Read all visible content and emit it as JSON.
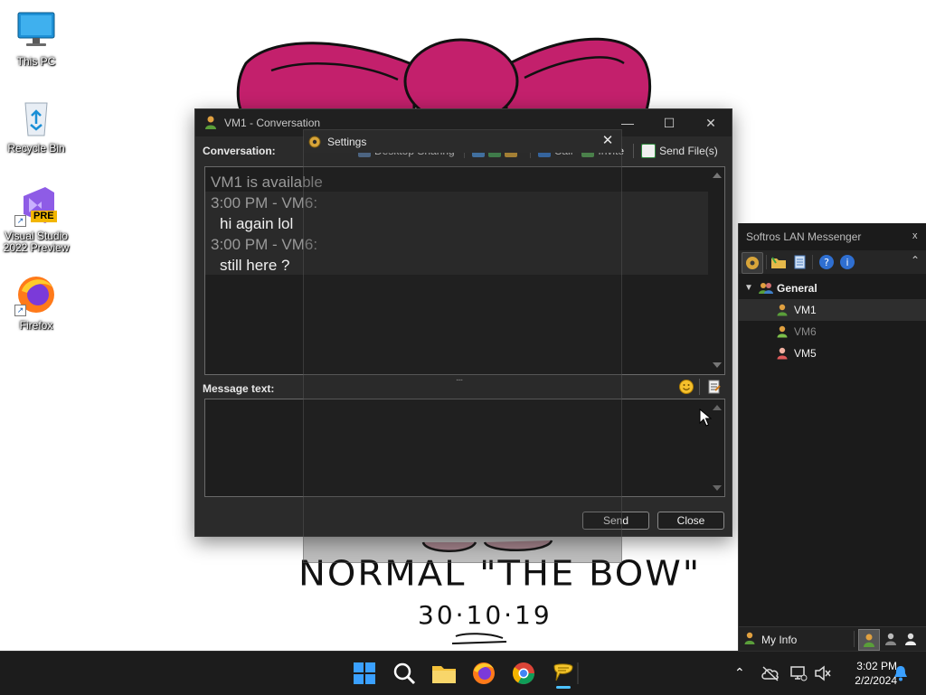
{
  "desktop": {
    "icons": [
      {
        "label": "This PC"
      },
      {
        "label": "Recycle Bin"
      },
      {
        "label": "Visual Studio 2022 Preview",
        "badge": "PRE"
      },
      {
        "label": "Firefox"
      }
    ]
  },
  "wallpaper": {
    "caption": "NORMAL \"THE BOW\"",
    "date": "30·10·19"
  },
  "conversation_window": {
    "title": "VM1 - Conversation",
    "conversation_label": "Conversation:",
    "toolbar": {
      "desktop_sharing": "Desktop Sharing",
      "call": "Call",
      "invite": "Invite",
      "send_files": "Send File(s)"
    },
    "history": [
      {
        "text": "VM1 is available",
        "kind": "status"
      },
      {
        "text": "3:00 PM - VM6:",
        "kind": "header"
      },
      {
        "text": "hi again lol",
        "kind": "message"
      },
      {
        "text": "3:00 PM - VM6:",
        "kind": "header"
      },
      {
        "text": "still here ?",
        "kind": "message"
      }
    ],
    "splitter_glyph": "....",
    "message_label": "Message text:",
    "message_value": "",
    "send_label": "Send",
    "close_label": "Close"
  },
  "settings_window": {
    "title": "Settings",
    "close_glyph": "✕"
  },
  "messenger": {
    "title": "Softros LAN Messenger",
    "close_glyph": "x",
    "group": "General",
    "contacts": [
      {
        "name": "VM1",
        "status": "online",
        "color": "#e0a040"
      },
      {
        "name": "VM6",
        "status": "away",
        "color": "#7cbf4a"
      },
      {
        "name": "VM5",
        "status": "busy",
        "color": "#e05a5a"
      }
    ],
    "my_info_label": "My Info"
  },
  "taskbar": {
    "time": "3:02 PM",
    "date": "2/2/2024"
  },
  "colors": {
    "window_bg": "#2b2b2b",
    "text_area_bg": "#1e1e1e",
    "accent": "#0078d4",
    "bow_pink": "#c3206c"
  }
}
